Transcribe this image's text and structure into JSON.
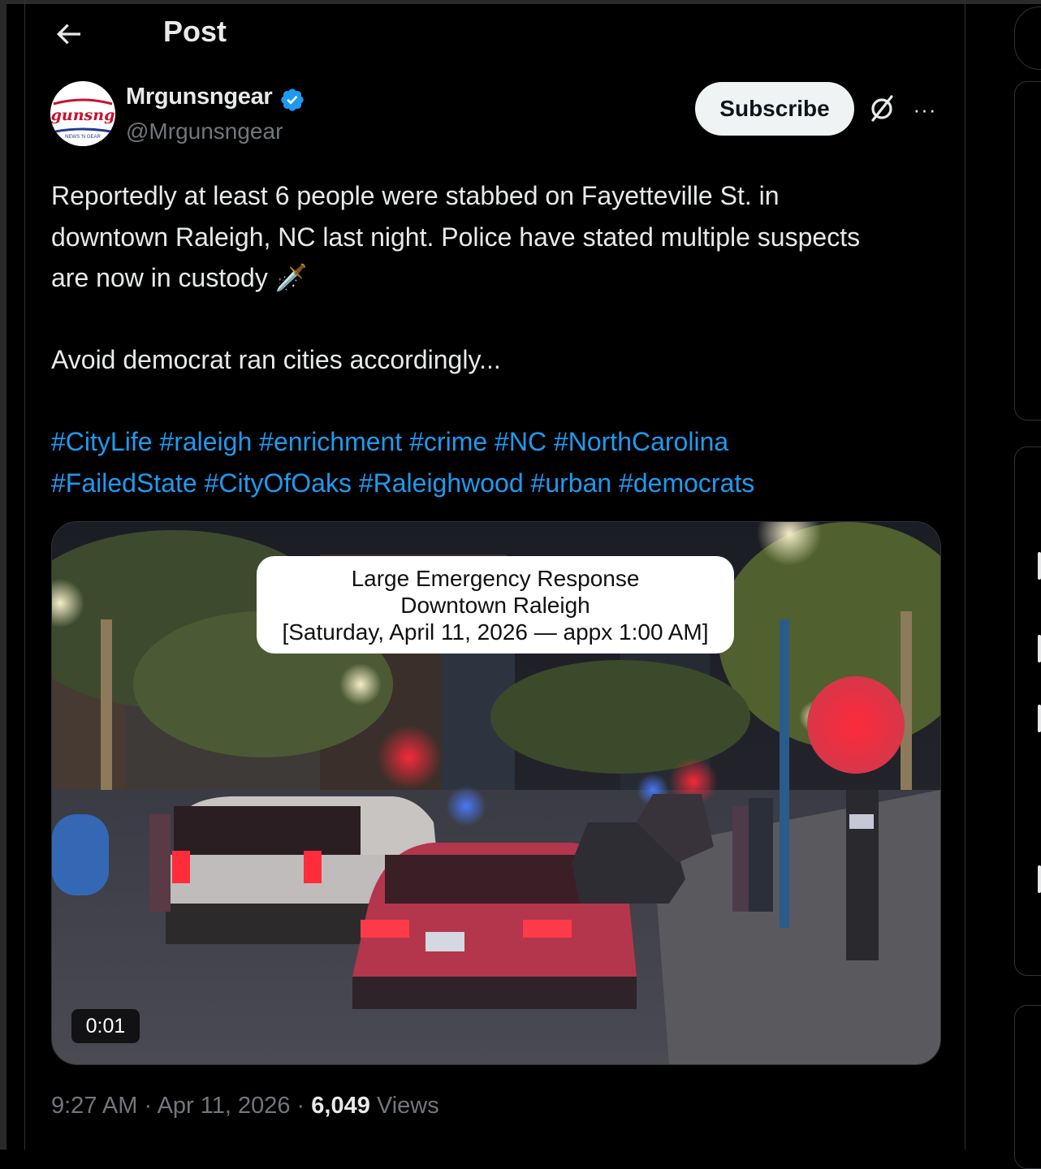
{
  "header": {
    "title": "Post"
  },
  "author": {
    "name": "Mrgunsngear",
    "handle": "@Mrgunsngear",
    "avatar_text": "gunsng",
    "avatar_subtext": "NEWS 'N GEAR"
  },
  "actions": {
    "subscribe_label": "Subscribe",
    "more_label": "···"
  },
  "post": {
    "lines": [
      "Reportedly at least 6 people were stabbed on Fayetteville St. in",
      "downtown Raleigh, NC last night.   Police have stated multiple suspects",
      "are now in custody 🗡️"
    ],
    "line2": "Avoid democrat ran cities accordingly...",
    "hashtags_row1": [
      "#CityLife",
      "#raleigh",
      "#enrichment",
      "#crime",
      "#NC",
      "#NorthCarolina"
    ],
    "hashtags_row2": [
      "#FailedState",
      "#CityOfOaks",
      "#Raleighwood",
      "#urban",
      "#democrats"
    ]
  },
  "media": {
    "caption_line1": "Large Emergency Response",
    "caption_line2": "Downtown Raleigh",
    "caption_line3": "[Saturday, April 11, 2026 — appx 1:00 AM]",
    "timestamp": "0:01"
  },
  "meta": {
    "time": "9:27 AM",
    "separator": " · ",
    "date": "Apr 11, 2026",
    "views_count": "6,049",
    "views_label": " Views"
  },
  "colors": {
    "background": "#000000",
    "text": "#e7e9ea",
    "muted": "#71767b",
    "link": "#1d9bf0",
    "verified": "#1d9bf0",
    "border": "#2f3336"
  }
}
